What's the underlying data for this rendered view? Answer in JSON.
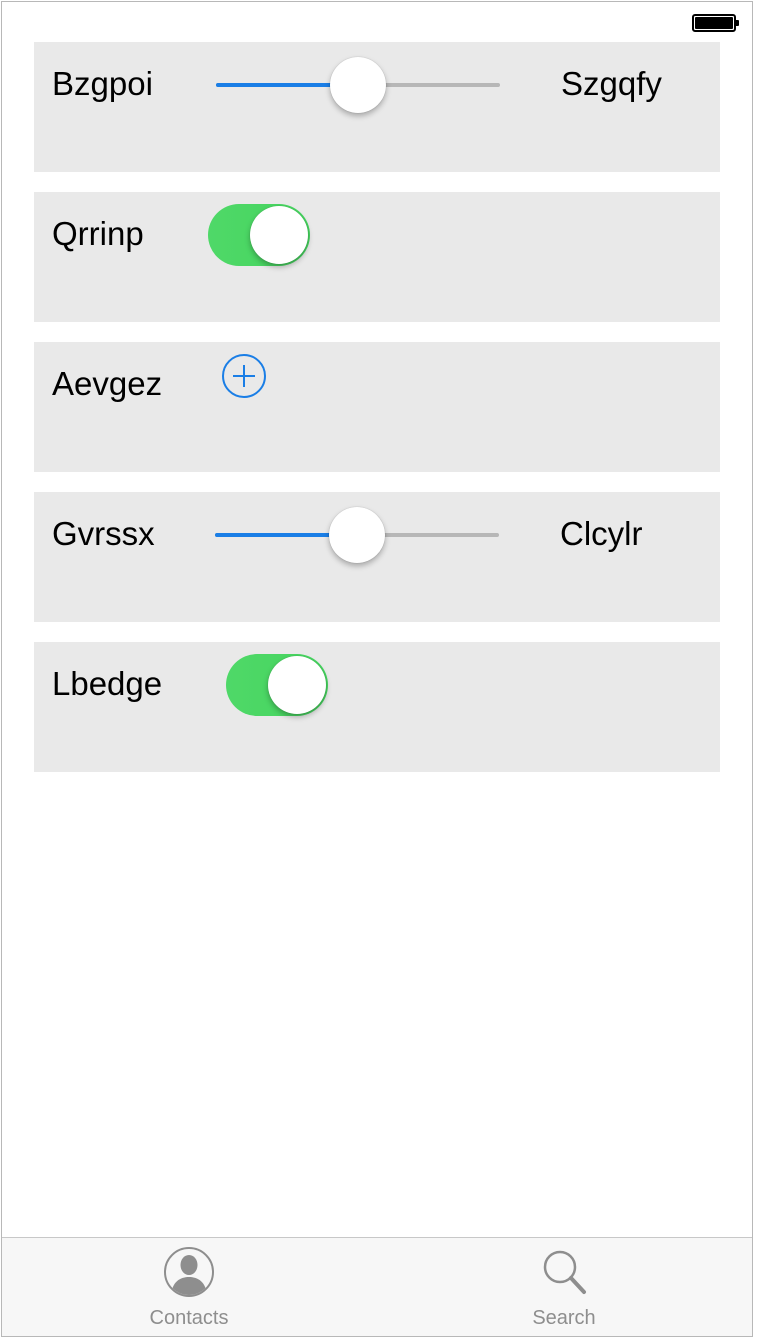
{
  "status_bar": {
    "battery_icon": "battery-full-icon"
  },
  "rows": [
    {
      "type": "slider",
      "label": "Bzgpoi",
      "value_label": "Szgqfy",
      "value": 0.5
    },
    {
      "type": "switch",
      "label": "Qrrinp",
      "on": true
    },
    {
      "type": "add",
      "label": "Aevgez",
      "icon": "plus-circle-icon"
    },
    {
      "type": "slider",
      "label": "Gvrssx",
      "value_label": "Clcylr",
      "value": 0.5
    },
    {
      "type": "switch",
      "label": "Lbedge",
      "on": true
    }
  ],
  "tab_bar": {
    "tabs": [
      {
        "label": "Contacts",
        "icon": "contacts-icon"
      },
      {
        "label": "Search",
        "icon": "search-icon"
      }
    ]
  },
  "colors": {
    "accent": "#1a7ee6",
    "switch_on": "#4cd964",
    "row_background": "#e9e9e9",
    "tab_inactive": "#8e8e8e"
  }
}
